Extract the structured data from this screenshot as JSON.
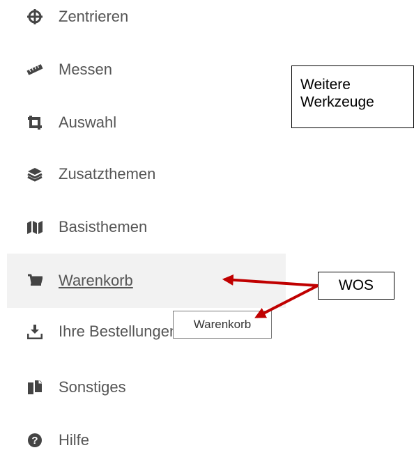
{
  "menu": {
    "items": [
      {
        "label": "Zentrieren",
        "icon": "crosshairs-icon"
      },
      {
        "label": "Messen",
        "icon": "ruler-icon"
      },
      {
        "label": "Auswahl",
        "icon": "crop-icon"
      },
      {
        "label": "Zusatzthemen",
        "icon": "layers-icon"
      },
      {
        "label": "Basisthemen",
        "icon": "map-icon"
      },
      {
        "label": "Warenkorb",
        "icon": "cart-icon",
        "active": true
      },
      {
        "label": "Ihre Bestellungen",
        "icon": "download-icon"
      },
      {
        "label": "Sonstiges",
        "icon": "files-icon"
      },
      {
        "label": "Hilfe",
        "icon": "help-icon"
      }
    ]
  },
  "tooltip": {
    "text": "Warenkorb"
  },
  "callouts": {
    "weitere_line1": "Weitere",
    "weitere_line2": "Werkzeuge",
    "wos": "WOS"
  },
  "colors": {
    "text": "#555555",
    "icon": "#444444",
    "active_bg": "#f2f2f2",
    "arrow": "#c00000"
  }
}
